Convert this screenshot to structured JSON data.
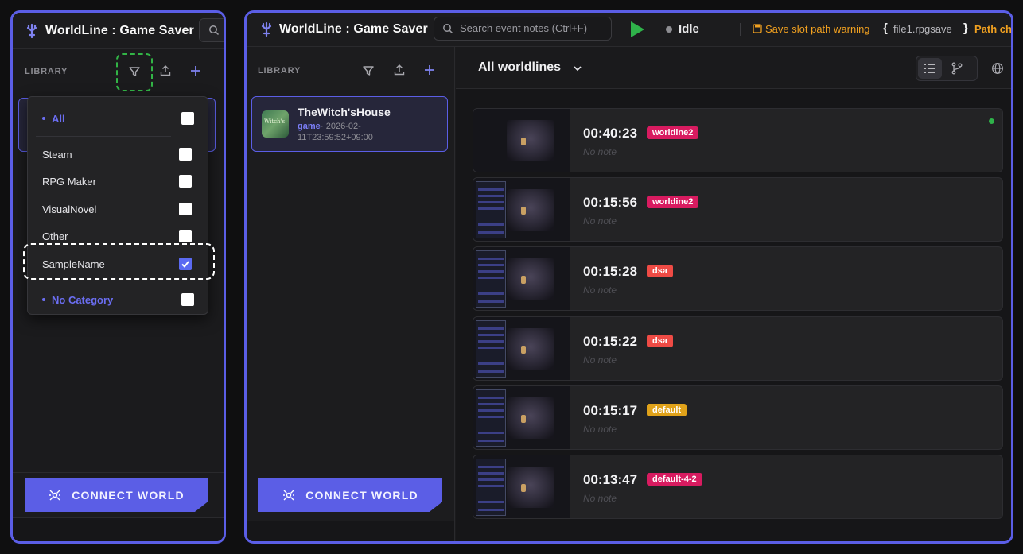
{
  "app": {
    "title": "WorldLine : Game Saver"
  },
  "library": {
    "label": "LIBRARY",
    "filter_options": [
      {
        "label": "All",
        "checked": false,
        "accent": true
      },
      {
        "label": "Steam",
        "checked": false,
        "accent": false
      },
      {
        "label": "RPG Maker",
        "checked": false,
        "accent": false
      },
      {
        "label": "VisualNovel",
        "checked": false,
        "accent": false
      },
      {
        "label": "Other",
        "checked": false,
        "accent": false
      },
      {
        "label": "SampleName",
        "checked": true,
        "accent": false
      },
      {
        "label": "No Category",
        "checked": false,
        "accent": true
      }
    ],
    "games": [
      {
        "name": "TheWitch'sHouse",
        "category": "game",
        "date_line1": "· 2026-02-",
        "date_line2": "11T23:59:52+09:00",
        "thumb_text": "Witch's"
      }
    ]
  },
  "connect_button": {
    "label": "CONNECT WORLD"
  },
  "toolbar": {
    "search_placeholder": "Search event notes (Ctrl+F)",
    "status": "Idle",
    "warning_text": "Save slot path warning",
    "brace_open": "{",
    "warning_file": "file1.rpgsave",
    "brace_close": "}",
    "warning_path": "Path ch"
  },
  "main": {
    "worldline_select": "All worldlines",
    "saves": [
      {
        "time": "00:40:23",
        "badge": "worldine2",
        "badge_color": "#d81b60",
        "note": "No note",
        "active": true,
        "menu": false
      },
      {
        "time": "00:15:56",
        "badge": "worldine2",
        "badge_color": "#d81b60",
        "note": "No note",
        "active": false,
        "menu": true
      },
      {
        "time": "00:15:28",
        "badge": "dsa",
        "badge_color": "#ef4b45",
        "note": "No note",
        "active": false,
        "menu": true
      },
      {
        "time": "00:15:22",
        "badge": "dsa",
        "badge_color": "#ef4b45",
        "note": "No note",
        "active": false,
        "menu": true
      },
      {
        "time": "00:15:17",
        "badge": "default",
        "badge_color": "#e0a21a",
        "note": "No note",
        "active": false,
        "menu": true
      },
      {
        "time": "00:13:47",
        "badge": "default-4-2",
        "badge_color": "#d81b60",
        "note": "No note",
        "active": false,
        "menu": true
      }
    ]
  },
  "colors": {
    "accent": "#5b5ee6",
    "warning": "#f0a020",
    "success": "#2fb24a"
  }
}
